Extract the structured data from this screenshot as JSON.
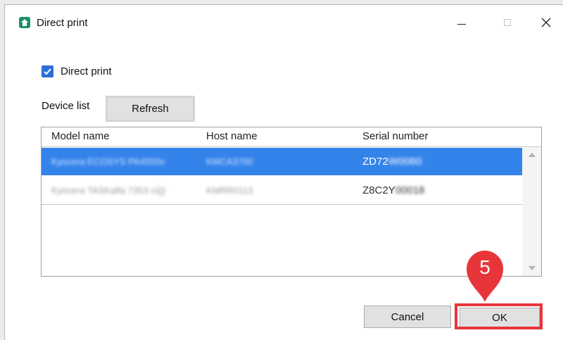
{
  "window": {
    "title": "Direct print",
    "icon": "app-print-icon",
    "controls": [
      "minimize-icon",
      "maximize-icon",
      "close-icon"
    ]
  },
  "direct_print": {
    "label": "Direct print",
    "checked": true
  },
  "device_list": {
    "label": "Device list",
    "refresh_label": "Refresh",
    "columns": [
      "Model name",
      "Host name",
      "Serial number"
    ],
    "rows": [
      {
        "model": "Kyocera ECOSYS PA4500x",
        "host": "KMCA3700",
        "serial_prefix": "ZD72",
        "serial_rest": "W0060",
        "selected": true
      },
      {
        "model": "Kyocera TASKalfa 7353 ci(j)",
        "host": "KMRR0113",
        "serial_prefix": "Z8C2Y",
        "serial_rest": "00018",
        "selected": false
      }
    ]
  },
  "buttons": {
    "cancel_label": "Cancel",
    "ok_label": "OK"
  },
  "callout": {
    "step": "5"
  },
  "colors": {
    "selection": "#3483eb",
    "checkbox": "#2a6fd6",
    "highlight": "#e8353a",
    "app_icon": "#1e8f6a"
  }
}
